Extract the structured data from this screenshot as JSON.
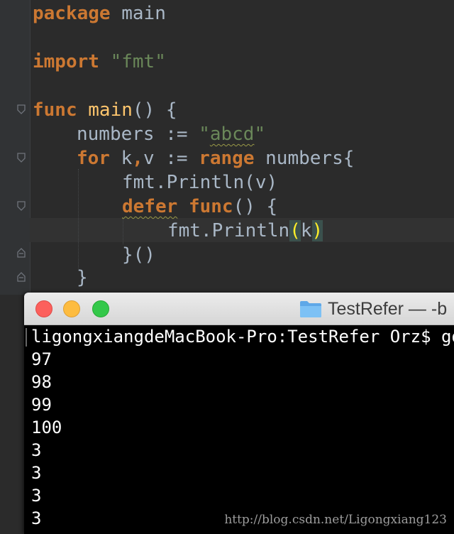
{
  "editor": {
    "lines": [
      {
        "segments": [
          {
            "text": "package",
            "cls": "kw"
          },
          {
            "text": " main",
            "cls": "plain"
          }
        ]
      },
      {
        "segments": [
          {
            "text": "import",
            "cls": "kw"
          },
          {
            "text": " ",
            "cls": "plain"
          },
          {
            "text": "\"fmt\"",
            "cls": "str"
          }
        ]
      },
      {
        "segments": [
          {
            "text": "func",
            "cls": "kw"
          },
          {
            "text": " ",
            "cls": "plain"
          },
          {
            "text": "main",
            "cls": "fn"
          },
          {
            "text": "() {",
            "cls": "plain"
          }
        ]
      },
      {
        "segments": [
          {
            "text": "numbers := ",
            "cls": "plain"
          },
          {
            "text": "\"",
            "cls": "str"
          },
          {
            "text": "abcd",
            "cls": "str squig"
          },
          {
            "text": "\"",
            "cls": "str"
          }
        ]
      },
      {
        "segments": [
          {
            "text": "for",
            "cls": "kw"
          },
          {
            "text": " k",
            "cls": "plain"
          },
          {
            "text": ",",
            "cls": "kw"
          },
          {
            "text": "v := ",
            "cls": "plain"
          },
          {
            "text": "range",
            "cls": "kw"
          },
          {
            "text": " numbers{",
            "cls": "plain"
          }
        ]
      },
      {
        "segments": [
          {
            "text": "fmt.Println(v)",
            "cls": "plain"
          }
        ]
      },
      {
        "segments": [
          {
            "text": "defer",
            "cls": "kw squig"
          },
          {
            "text": " ",
            "cls": "plain"
          },
          {
            "text": "func",
            "cls": "kw"
          },
          {
            "text": "() {",
            "cls": "plain"
          }
        ]
      },
      {
        "segments": [
          {
            "text": "fmt.Println",
            "cls": "plain"
          },
          {
            "text": "(",
            "cls": "paren-hl"
          },
          {
            "text": "k",
            "cls": "plain"
          },
          {
            "text": ")",
            "cls": "paren-hl"
          }
        ]
      },
      {
        "segments": [
          {
            "text": "}()",
            "cls": "plain"
          }
        ]
      },
      {
        "segments": [
          {
            "text": "}",
            "cls": "plain"
          }
        ]
      }
    ]
  },
  "terminal": {
    "window_title": "TestRefer — -b",
    "prompt_line": "ligongxiangdeMacBook-Pro:TestRefer Orz$ go",
    "output": [
      "97",
      "98",
      "99",
      "100",
      "3",
      "3",
      "3",
      "3"
    ]
  },
  "watermark": "http://blog.csdn.net/Ligongxiang123",
  "colors": {
    "editor_bg": "#2b2b2b",
    "keyword": "#cc7832",
    "string": "#6a8759",
    "function": "#ffc66d",
    "default_text": "#a9b7c6",
    "terminal_bg": "#000000",
    "terminal_text": "#ffffff"
  }
}
